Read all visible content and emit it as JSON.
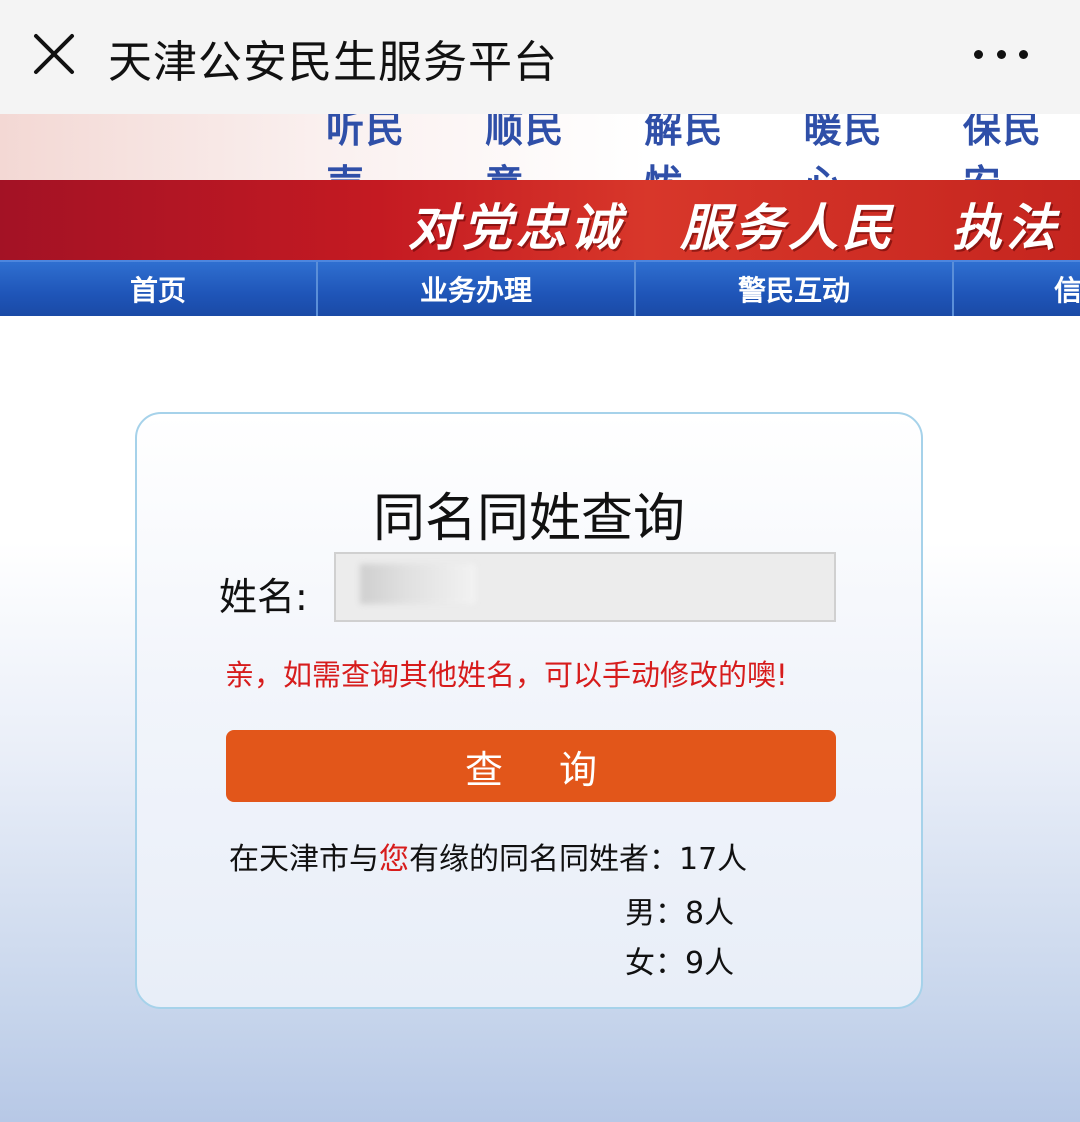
{
  "header": {
    "title": "天津公安民生服务平台"
  },
  "banner": {
    "slogans": [
      "听民声",
      "顺民意",
      "解民忧",
      "暖民心",
      "保民安"
    ],
    "motto": [
      "对党忠诚",
      "服务人民",
      "执法"
    ]
  },
  "nav": {
    "items": [
      {
        "label": "首页"
      },
      {
        "label": "业务办理"
      },
      {
        "label": "警民互动"
      },
      {
        "label": "信"
      }
    ]
  },
  "query": {
    "title": "同名同姓查询",
    "name_label": "姓名:",
    "hint": "亲，如需查询其他姓名，可以手动修改的噢!",
    "button_label": "查 询",
    "result_prefix": "在天津市与",
    "result_highlight": "您",
    "result_suffix": "有缘的同名同姓者：17人",
    "male_text": "男：8人",
    "female_text": "女：9人"
  }
}
